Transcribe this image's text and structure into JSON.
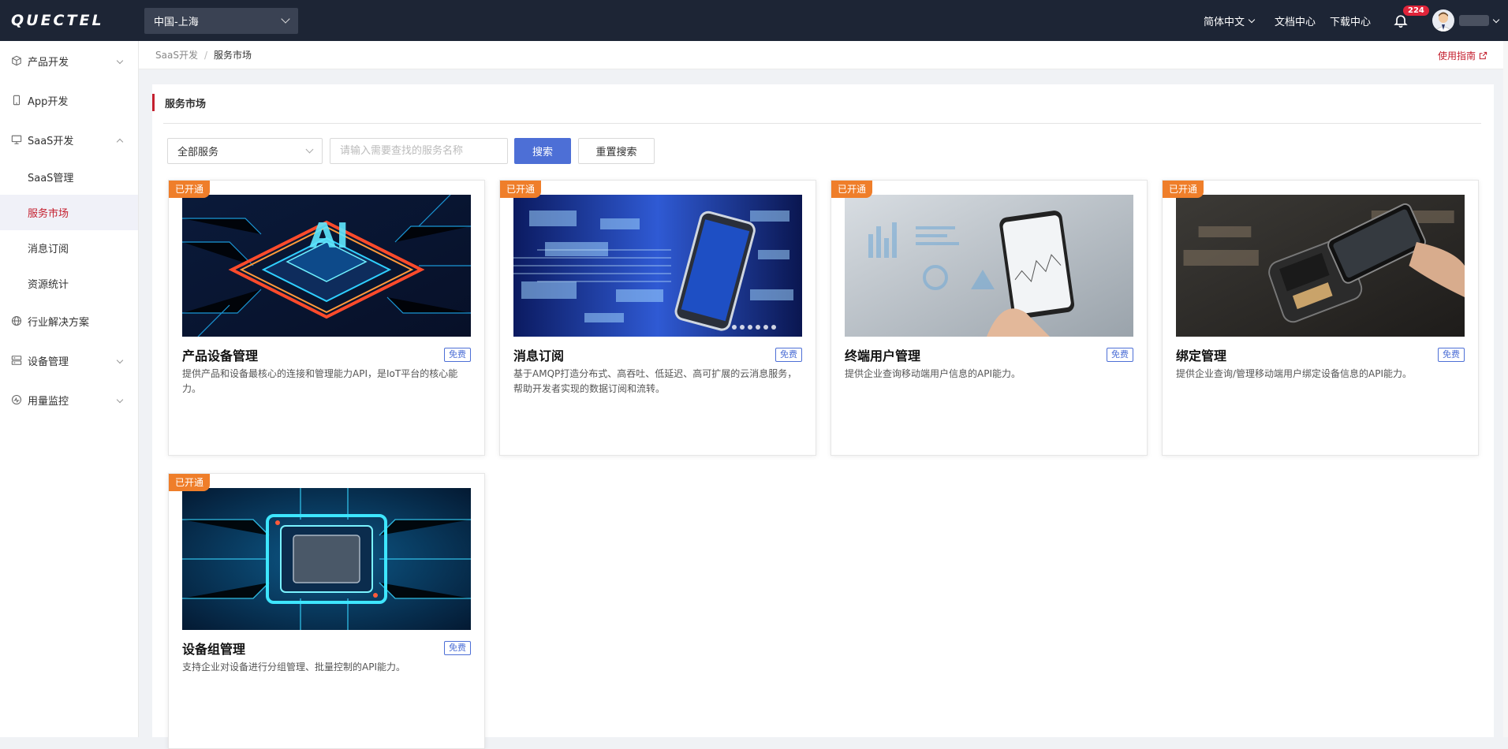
{
  "topbar": {
    "logo": "QUECTEL",
    "region": "中国-上海",
    "language": "简体中文",
    "docs": "文档中心",
    "downloads": "下载中心",
    "notification_count": "224"
  },
  "sidebar": {
    "items": [
      {
        "label": "产品开发",
        "icon": "cube-icon"
      },
      {
        "label": "App开发",
        "icon": "phone-icon"
      },
      {
        "label": "SaaS开发",
        "icon": "monitor-icon"
      },
      {
        "label": "SaaS管理"
      },
      {
        "label": "服务市场"
      },
      {
        "label": "消息订阅"
      },
      {
        "label": "资源统计"
      },
      {
        "label": "行业解决方案",
        "icon": "globe-icon"
      },
      {
        "label": "设备管理",
        "icon": "server-icon"
      },
      {
        "label": "用量监控",
        "icon": "gauge-icon"
      }
    ]
  },
  "breadcrumb": {
    "parent": "SaaS开发",
    "separator": "/",
    "current": "服务市场",
    "guide": "使用指南"
  },
  "main": {
    "title": "服务市场",
    "filter_value": "全部服务",
    "search_placeholder": "请输入需要查找的服务名称",
    "search_button": "搜索",
    "reset_button": "重置搜索"
  },
  "cards": [
    {
      "tag": "已开通",
      "title": "产品设备管理",
      "free": "免费",
      "desc": "提供产品和设备最核心的连接和管理能力API，是IoT平台的核心能力。"
    },
    {
      "tag": "已开通",
      "title": "消息订阅",
      "free": "免费",
      "desc": "基于AMQP打造分布式、高吞吐、低延迟、高可扩展的云消息服务，帮助开发者实现的数据订阅和流转。"
    },
    {
      "tag": "已开通",
      "title": "终端用户管理",
      "free": "免费",
      "desc": "提供企业查询移动端用户信息的API能力。"
    },
    {
      "tag": "已开通",
      "title": "绑定管理",
      "free": "免费",
      "desc": "提供企业查询/管理移动端用户绑定设备信息的API能力。"
    },
    {
      "tag": "已开通",
      "title": "设备组管理",
      "free": "免费",
      "desc": "支持企业对设备进行分组管理、批量控制的API能力。"
    }
  ],
  "colors": {
    "topbar": "#1d2535",
    "accent_red": "#c4202f",
    "primary_blue": "#4d6fd6",
    "tag_orange": "#ef7e2a"
  }
}
